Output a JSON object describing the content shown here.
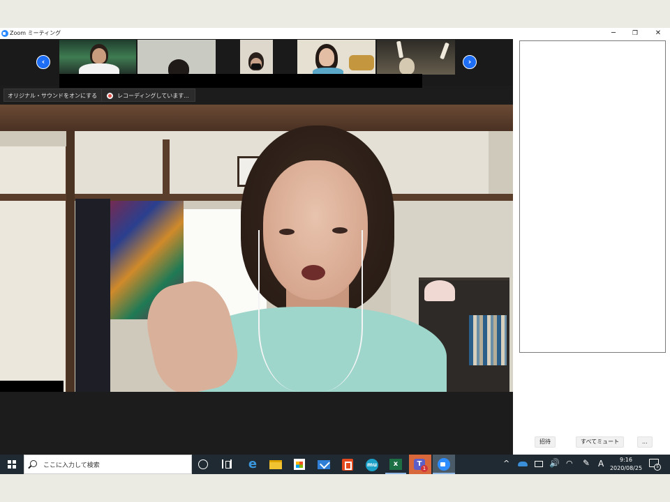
{
  "window": {
    "title": "Zoom ミーティング",
    "minimize_glyph": "─",
    "restore_glyph": "❐",
    "close_glyph": "✕"
  },
  "thumbnail_strip": {
    "prev_glyph": "‹",
    "next_glyph": "›",
    "participant_count_visible": 5
  },
  "overlay_controls": {
    "original_sound_label": "オリジナル・サウンドをオンにする",
    "dropdown_glyph": "▾",
    "recording_label": "レコーディングしています..."
  },
  "side_panel": {
    "invite_label": "招待",
    "mute_all_label": "すべてミュート",
    "more_label": "..."
  },
  "taskbar": {
    "search_placeholder": "ここに入力して検索",
    "edge_glyph": "e",
    "mu_glyph": "mu",
    "excel_glyph": "x",
    "teams_glyph": "T",
    "teams_badge": "1",
    "tray_chevron": "^",
    "volume_glyph": "🔊",
    "network_glyph": "◠",
    "pen_glyph": "✎",
    "ime_label": "A",
    "clock_time": "9:16",
    "clock_date": "2020/08/25",
    "notification_badge": "5"
  },
  "icons": {
    "app": "zoom-app-icon",
    "start": "windows-logo-icon",
    "search": "magnifier-icon",
    "cortana": "cortana-ring-icon",
    "task_view": "task-view-icon",
    "edge": "edge-browser-icon",
    "explorer": "folder-icon",
    "store": "store-bag-icon",
    "mail": "mail-envelope-icon",
    "office": "office-icon",
    "excel": "excel-icon",
    "teams": "teams-icon",
    "zoom": "zoom-camera-icon"
  },
  "colors": {
    "zoom_blue": "#2d8cff",
    "nav_arrow_blue": "#1e6ef5",
    "recording_red": "#e25048",
    "taskbar_bg": "#1f2a32",
    "teams_tile": "#d8673c",
    "video_bg": "#1c1c1c"
  }
}
